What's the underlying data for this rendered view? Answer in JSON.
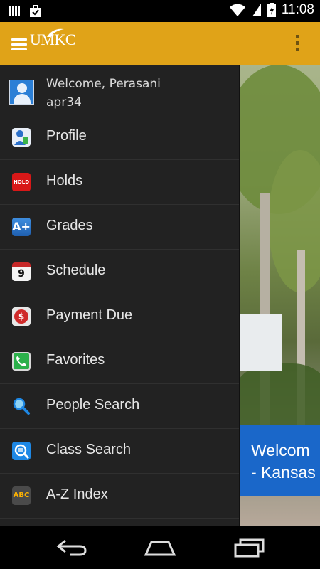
{
  "status_bar": {
    "time": "11:08",
    "icons": [
      "signal-bars-icon",
      "bag-check-icon",
      "wifi-icon",
      "no-sim-icon",
      "battery-charging-icon"
    ]
  },
  "app_bar": {
    "logo_text": "UMKC",
    "menu_icon": "hamburger-icon",
    "overflow_icon": "overflow-menu-icon"
  },
  "drawer": {
    "user": {
      "welcome": "Welcome, Perasani",
      "username": "apr34"
    },
    "items": [
      {
        "label": "Profile",
        "icon": "profile-icon"
      },
      {
        "label": "Holds",
        "icon": "holds-icon",
        "icon_text": "HOLD"
      },
      {
        "label": "Grades",
        "icon": "grades-icon",
        "icon_text": "A+"
      },
      {
        "label": "Schedule",
        "icon": "calendar-icon",
        "icon_text": "9"
      },
      {
        "label": "Payment Due",
        "icon": "payment-icon",
        "icon_text": "$"
      },
      {
        "label": "Favorites",
        "icon": "phone-icon"
      },
      {
        "label": "People Search",
        "icon": "magnifier-icon"
      },
      {
        "label": "Class Search",
        "icon": "class-search-icon"
      },
      {
        "label": "A-Z Index",
        "icon": "abc-index-icon",
        "icon_text": "ABC"
      }
    ]
  },
  "content": {
    "banner_line1": "Welcom",
    "banner_line2": "- Kansas"
  },
  "nav_bar": {
    "back": "back-icon",
    "home": "home-icon",
    "recents": "recents-icon"
  },
  "colors": {
    "app_bar": "#e0a318",
    "drawer_bg": "#222222",
    "banner": "#1a67c9"
  }
}
